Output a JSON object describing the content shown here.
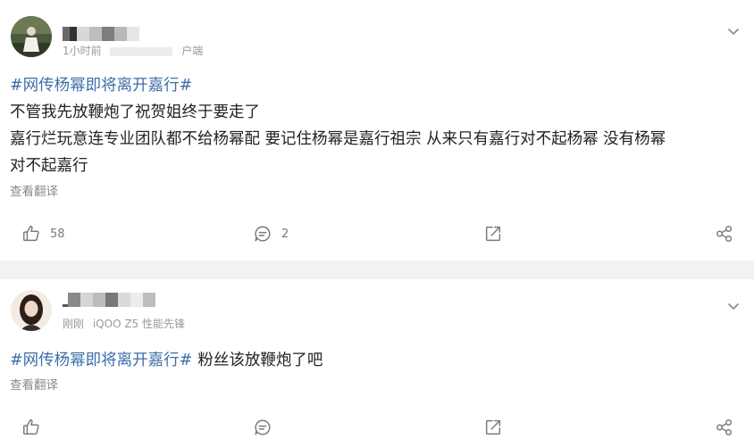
{
  "posts": [
    {
      "meta_time": "1小时前",
      "meta_client": "户端",
      "topic": "#网传杨幂即将离开嘉行#",
      "lines": [
        "不管我先放鞭炮了祝贺姐终于要走了",
        "嘉行烂玩意连专业团队都不给杨幂配 要记住杨幂是嘉行祖宗 从来只有嘉行对不起杨幂 没有杨幂",
        "对不起嘉行"
      ],
      "translate_label": "查看翻译",
      "like_count": "58",
      "comment_count": "2",
      "icons": [
        "like-icon",
        "comment-icon",
        "share-icon",
        "repost-icon",
        "chevron-down-icon"
      ]
    },
    {
      "meta_time": "刚刚",
      "meta_device": "iQOO Z5 性能先锋",
      "topic": "#网传杨幂即将离开嘉行#",
      "text": "粉丝该放鞭炮了吧",
      "translate_label": "查看翻译",
      "like_count": "",
      "comment_count": "",
      "icons": [
        "like-icon",
        "comment-icon",
        "share-icon",
        "repost-icon",
        "chevron-down-icon"
      ]
    }
  ],
  "colors": {
    "topic": "#3d6ea8",
    "text": "#222222",
    "muted": "#999999",
    "separator": "#f2f2f2"
  }
}
